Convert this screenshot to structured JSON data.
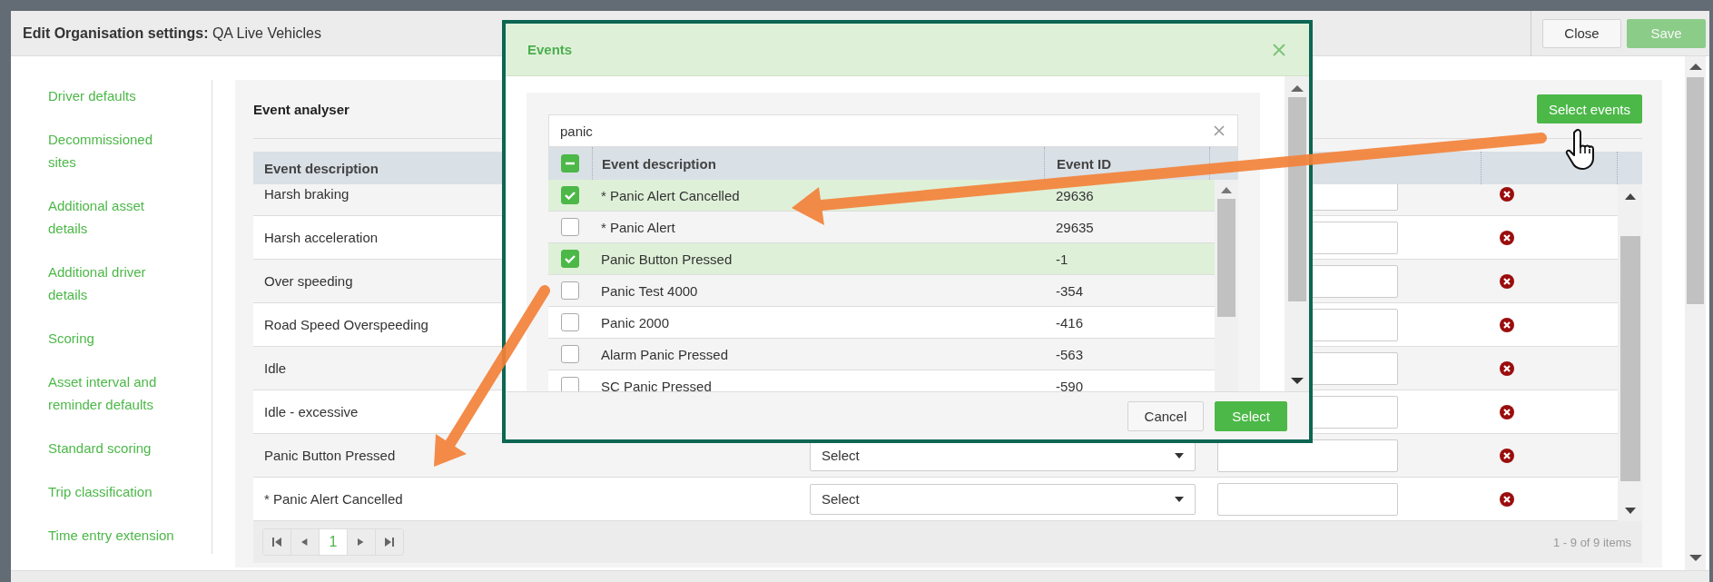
{
  "header": {
    "title_label": "Edit Organisation settings:",
    "title_value": "QA Live Vehicles",
    "buttons": [
      {
        "label": "Close",
        "kind": "secondary",
        "disabled": false
      },
      {
        "label": "Save",
        "kind": "primary",
        "disabled": true
      }
    ]
  },
  "sidebar": {
    "items": [
      "Driver defaults",
      "Decommissioned sites",
      "Additional asset details",
      "Additional driver details",
      "Scoring",
      "Asset interval and reminder defaults",
      "Standard scoring",
      "Trip classification",
      "Time entry extension"
    ]
  },
  "event_analyser": {
    "title": "Event analyser",
    "select_button": "Select events",
    "columns": [
      "Event description"
    ],
    "rows": [
      {
        "description": "Harsh braking"
      },
      {
        "description": "Harsh acceleration"
      },
      {
        "description": "Over speeding"
      },
      {
        "description": "Road Speed Overspeeding"
      },
      {
        "description": "Idle"
      },
      {
        "description": "Idle - excessive"
      },
      {
        "description": "Panic Button Pressed",
        "select": "Select"
      },
      {
        "description": "* Panic Alert Cancelled",
        "select": "Select"
      }
    ],
    "pager": {
      "page": "1",
      "summary": "1 - 9 of 9 items"
    }
  },
  "events_dialog": {
    "title": "Events",
    "search": {
      "value": "panic"
    },
    "select_all": {
      "checked": true,
      "indeterminate": true
    },
    "columns": [
      "Event description",
      "Event ID"
    ],
    "rows": [
      {
        "description": "* Panic Alert Cancelled",
        "event_id": "29636",
        "checked": true
      },
      {
        "description": "* Panic Alert",
        "event_id": "29635",
        "checked": false
      },
      {
        "description": "Panic Button Pressed",
        "event_id": "-1",
        "checked": true
      },
      {
        "description": "Panic Test 4000",
        "event_id": "-354",
        "checked": false
      },
      {
        "description": "Panic 2000",
        "event_id": "-416",
        "checked": false
      },
      {
        "description": "Alarm Panic Pressed",
        "event_id": "-563",
        "checked": false
      },
      {
        "description": "SC Panic Pressed",
        "event_id": "-590",
        "checked": false
      }
    ],
    "buttons": [
      {
        "label": "Cancel",
        "kind": "secondary"
      },
      {
        "label": "Select",
        "kind": "primary"
      }
    ]
  }
}
